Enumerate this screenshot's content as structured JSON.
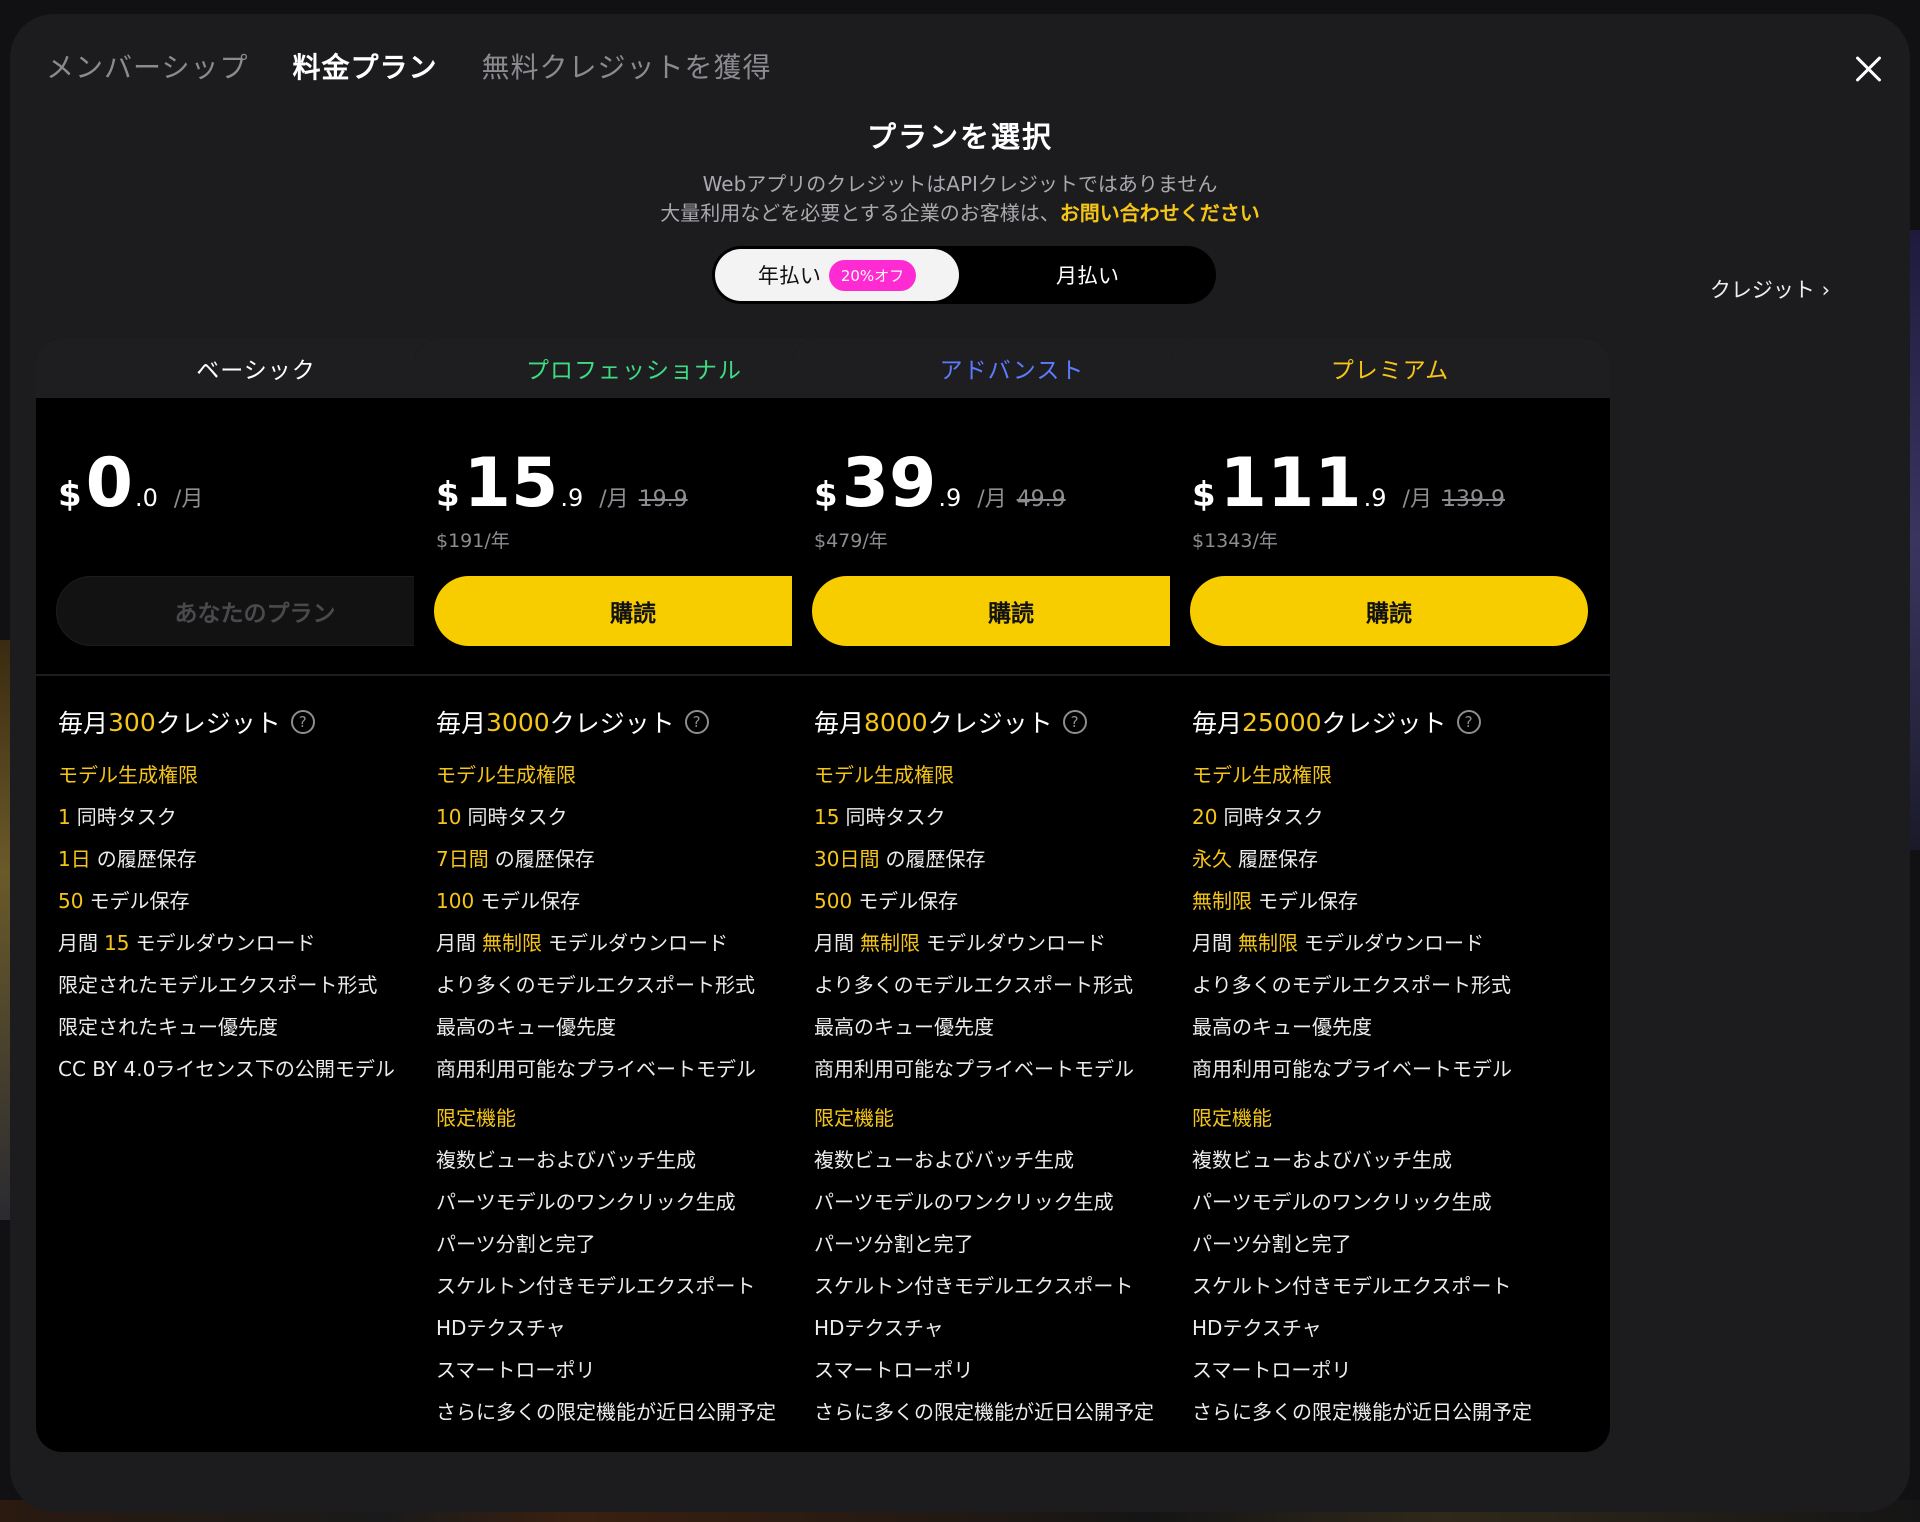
{
  "tabs": [
    "メンバーシップ",
    "料金プラン",
    "無料クレジットを獲得"
  ],
  "heading": "プランを選択",
  "sub1": "WebアプリのクレジットはAPIクレジットではありません",
  "sub2_text": "大量利用などを必要とする企業のお客様は、",
  "sub2_link": "お問い合わせください",
  "toggle": {
    "year": "年払い",
    "badge": "20%オフ",
    "month": "月払い"
  },
  "credit_link": "クレジット ›",
  "colors": {
    "basic": "#ffffff",
    "pro": "#3ddc84",
    "advanced": "#5b7cff",
    "premium": "#f5c518",
    "accent": "#f7cd00",
    "badge": "#ff2bd2"
  },
  "plans": [
    {
      "name": "ベーシック",
      "currency": "$",
      "big": "0",
      "dec": ".0",
      "unit": "/月",
      "old": "",
      "yearly": "",
      "button": "あなたのプラン",
      "credits_pre": "毎月",
      "credits": "300",
      "credits_post": " クレジット",
      "sec1": "モデル生成権限",
      "rows": [
        [
          "1",
          "同時タスク"
        ],
        [
          "1日",
          "の履歴保存"
        ],
        [
          "50",
          "モデル保存"
        ],
        [
          "月間",
          "15",
          "モデルダウンロード"
        ],
        [
          "",
          "限定されたモデルエクスポート形式"
        ],
        [
          "",
          "限定されたキュー優先度"
        ],
        [
          "",
          "CC BY 4.0ライセンス下の公開モデル"
        ]
      ],
      "sec2": "",
      "extras": []
    },
    {
      "name": "プロフェッショナル",
      "currency": "$",
      "big": "15",
      "dec": ".9",
      "unit": "/月",
      "old": "19.9",
      "yearly": "$191/年",
      "button": "購読",
      "credits_pre": "毎月",
      "credits": "3000",
      "credits_post": " クレジット",
      "sec1": "モデル生成権限",
      "rows": [
        [
          "10",
          "同時タスク"
        ],
        [
          "7日間",
          "の履歴保存"
        ],
        [
          "100",
          "モデル保存"
        ],
        [
          "月間",
          "無制限",
          "モデルダウンロード"
        ],
        [
          "",
          "より多くのモデルエクスポート形式"
        ],
        [
          "",
          "最高のキュー優先度"
        ],
        [
          "",
          "商用利用可能なプライベートモデル"
        ]
      ],
      "sec2": "限定機能",
      "extras": [
        "複数ビューおよびバッチ生成",
        "パーツモデルのワンクリック生成",
        "パーツ分割と完了",
        "スケルトン付きモデルエクスポート",
        "HDテクスチャ",
        "スマートローポリ",
        "さらに多くの限定機能が近日公開予定"
      ]
    },
    {
      "name": "アドバンスト",
      "currency": "$",
      "big": "39",
      "dec": ".9",
      "unit": "/月",
      "old": "49.9",
      "yearly": "$479/年",
      "button": "購読",
      "credits_pre": "毎月",
      "credits": "8000",
      "credits_post": " クレジット",
      "sec1": "モデル生成権限",
      "rows": [
        [
          "15",
          "同時タスク"
        ],
        [
          "30日間",
          "の履歴保存"
        ],
        [
          "500",
          "モデル保存"
        ],
        [
          "月間",
          "無制限",
          "モデルダウンロード"
        ],
        [
          "",
          "より多くのモデルエクスポート形式"
        ],
        [
          "",
          "最高のキュー優先度"
        ],
        [
          "",
          "商用利用可能なプライベートモデル"
        ]
      ],
      "sec2": "限定機能",
      "extras": [
        "複数ビューおよびバッチ生成",
        "パーツモデルのワンクリック生成",
        "パーツ分割と完了",
        "スケルトン付きモデルエクスポート",
        "HDテクスチャ",
        "スマートローポリ",
        "さらに多くの限定機能が近日公開予定"
      ]
    },
    {
      "name": "プレミアム",
      "currency": "$",
      "big": "111",
      "dec": ".9",
      "unit": "/月",
      "old": "139.9",
      "yearly": "$1343/年",
      "button": "購読",
      "credits_pre": "毎月",
      "credits": "25000",
      "credits_post": " クレジット",
      "sec1": "モデル生成権限",
      "rows": [
        [
          "20",
          "同時タスク"
        ],
        [
          "永久",
          "履歴保存"
        ],
        [
          "無制限",
          "モデル保存"
        ],
        [
          "月間",
          "無制限",
          "モデルダウンロード"
        ],
        [
          "",
          "より多くのモデルエクスポート形式"
        ],
        [
          "",
          "最高のキュー優先度"
        ],
        [
          "",
          "商用利用可能なプライベートモデル"
        ]
      ],
      "sec2": "限定機能",
      "extras": [
        "複数ビューおよびバッチ生成",
        "パーツモデルのワンクリック生成",
        "パーツ分割と完了",
        "スケルトン付きモデルエクスポート",
        "HDテクスチャ",
        "スマートローポリ",
        "さらに多くの限定機能が近日公開予定"
      ]
    }
  ]
}
